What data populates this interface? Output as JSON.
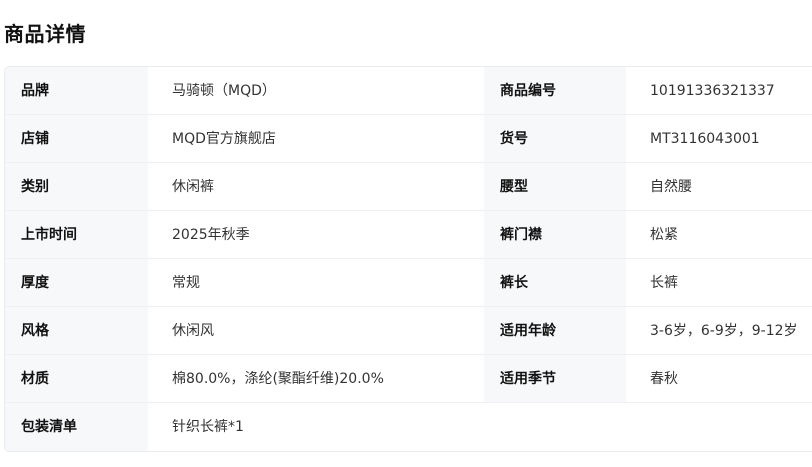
{
  "section": {
    "title": "商品详情"
  },
  "rows": [
    {
      "k1": "品牌",
      "v1": "马骑顿（MQD）",
      "k2": "商品编号",
      "v2": "10191336321337"
    },
    {
      "k1": "店铺",
      "v1": "MQD官方旗舰店",
      "k2": "货号",
      "v2": "MT3116043001"
    },
    {
      "k1": "类别",
      "v1": "休闲裤",
      "k2": "腰型",
      "v2": "自然腰"
    },
    {
      "k1": "上市时间",
      "v1": "2025年秋季",
      "k2": "裤门襟",
      "v2": "松紧"
    },
    {
      "k1": "厚度",
      "v1": "常规",
      "k2": "裤长",
      "v2": "长裤"
    },
    {
      "k1": "风格",
      "v1": "休闲风",
      "k2": "适用年龄",
      "v2": "3-6岁，6-9岁，9-12岁"
    },
    {
      "k1": "材质",
      "v1": "棉80.0%，涤纶(聚酯纤维)20.0%",
      "k2": "适用季节",
      "v2": "春秋"
    },
    {
      "k1": "包装清单",
      "v1": "针织长裤*1"
    }
  ]
}
